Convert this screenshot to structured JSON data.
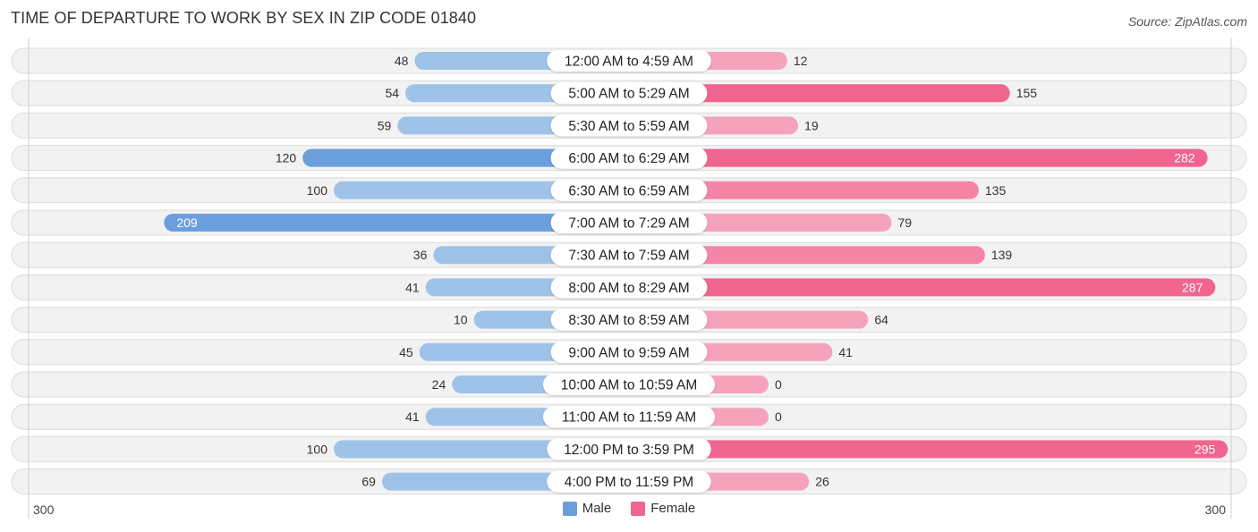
{
  "header": {
    "title": "TIME OF DEPARTURE TO WORK BY SEX IN ZIP CODE 01840",
    "source": "Source: ZipAtlas.com"
  },
  "colors": {
    "male": "#6a9fdb",
    "male_light": "#9fc2e8",
    "female": "#f06590",
    "female_light": "#f5a3bd",
    "row_bg": "#f2f2f2"
  },
  "chart_data": {
    "type": "bar",
    "orientation": "horizontal-diverging",
    "title": "TIME OF DEPARTURE TO WORK BY SEX IN ZIP CODE 01840",
    "categories": [
      "12:00 AM to 4:59 AM",
      "5:00 AM to 5:29 AM",
      "5:30 AM to 5:59 AM",
      "6:00 AM to 6:29 AM",
      "6:30 AM to 6:59 AM",
      "7:00 AM to 7:29 AM",
      "7:30 AM to 7:59 AM",
      "8:00 AM to 8:29 AM",
      "8:30 AM to 8:59 AM",
      "9:00 AM to 9:59 AM",
      "10:00 AM to 10:59 AM",
      "11:00 AM to 11:59 AM",
      "12:00 PM to 3:59 PM",
      "4:00 PM to 11:59 PM"
    ],
    "series": [
      {
        "name": "Male",
        "values": [
          48,
          54,
          59,
          120,
          100,
          209,
          36,
          41,
          10,
          45,
          24,
          41,
          100,
          69
        ]
      },
      {
        "name": "Female",
        "values": [
          12,
          155,
          19,
          282,
          135,
          79,
          139,
          287,
          64,
          41,
          0,
          0,
          295,
          26
        ]
      }
    ],
    "axis": {
      "left_label": "300",
      "right_label": "300",
      "range": [
        0,
        300
      ]
    },
    "legend": {
      "position": "bottom-center",
      "entries": [
        "Male",
        "Female"
      ]
    }
  }
}
